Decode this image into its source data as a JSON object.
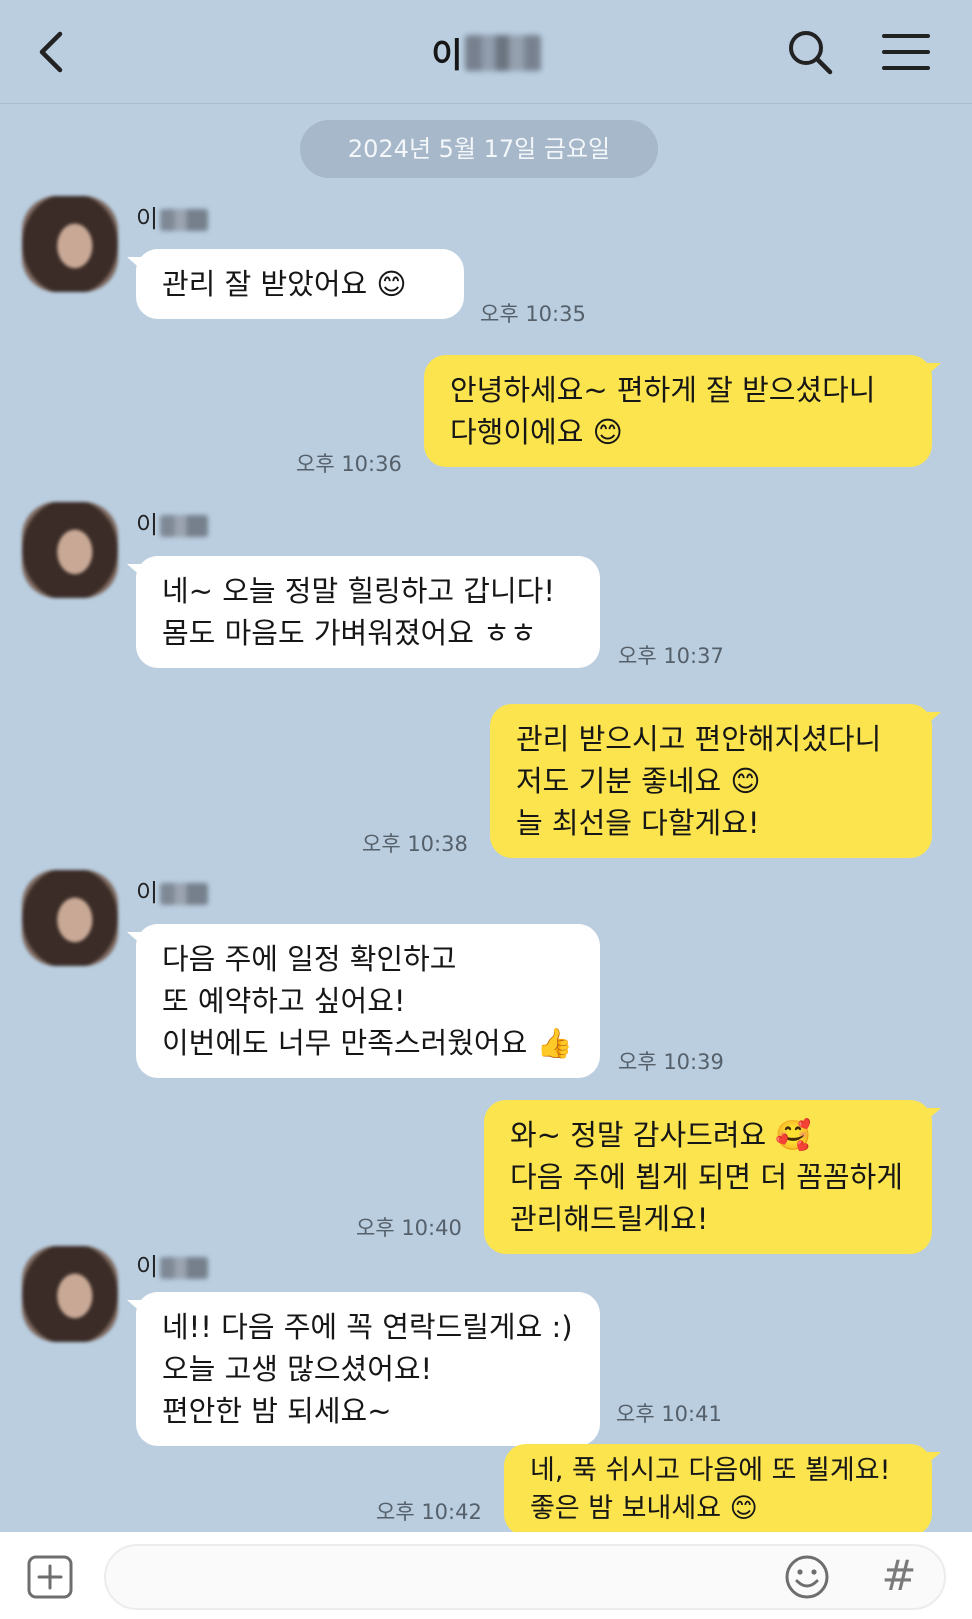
{
  "header": {
    "title_visible": "이"
  },
  "date_divider": "2024년 5월 17일 금요일",
  "contact": {
    "name_visible": "이"
  },
  "messages": [
    {
      "dir": "in",
      "lines": "관리 잘 받았어요 😊",
      "time": "오후 10:35"
    },
    {
      "dir": "out",
      "lines": "안녕하세요~ 편하게 잘 받으셨다니\n다행이에요 😊",
      "time": "오후 10:36"
    },
    {
      "dir": "in",
      "lines": "네~ 오늘 정말 힐링하고 갑니다!\n몸도 마음도 가벼워졌어요 ㅎㅎ",
      "time": "오후 10:37"
    },
    {
      "dir": "out",
      "lines": "관리 받으시고 편안해지셨다니\n저도 기분 좋네요 😊\n늘 최선을 다할게요!",
      "time": "오후 10:38"
    },
    {
      "dir": "in",
      "lines": "다음 주에 일정 확인하고\n또 예약하고 싶어요!\n이번에도 너무 만족스러웠어요 👍",
      "time": "오후 10:39"
    },
    {
      "dir": "out",
      "lines": "와~ 정말 감사드려요 🥰\n다음 주에 뵙게 되면 더 꼼꼼하게\n관리해드릴게요!",
      "time": "오후 10:40"
    },
    {
      "dir": "in",
      "lines": "네!! 다음 주에 꼭 연락드릴게요 :)\n오늘 고생 많으셨어요!\n편안한 밤 되세요~",
      "time": "오후 10:41"
    },
    {
      "dir": "out",
      "lines": "네, 푹 쉬시고 다음에 또 뵐게요!\n좋은 밤 보내세요 😊",
      "time": "오후 10:42"
    }
  ],
  "input_bar": {
    "hash_label": "#"
  },
  "colors": {
    "background": "#bacee0",
    "incoming_bubble": "#ffffff",
    "outgoing_bubble": "#fbe44e",
    "date_pill": "#a6b8c9",
    "time_text": "#55606b"
  },
  "icons": [
    "chevron-left-icon",
    "search-icon",
    "hamburger-menu-icon",
    "plus-square-icon",
    "smiley-icon",
    "hash-icon"
  ]
}
